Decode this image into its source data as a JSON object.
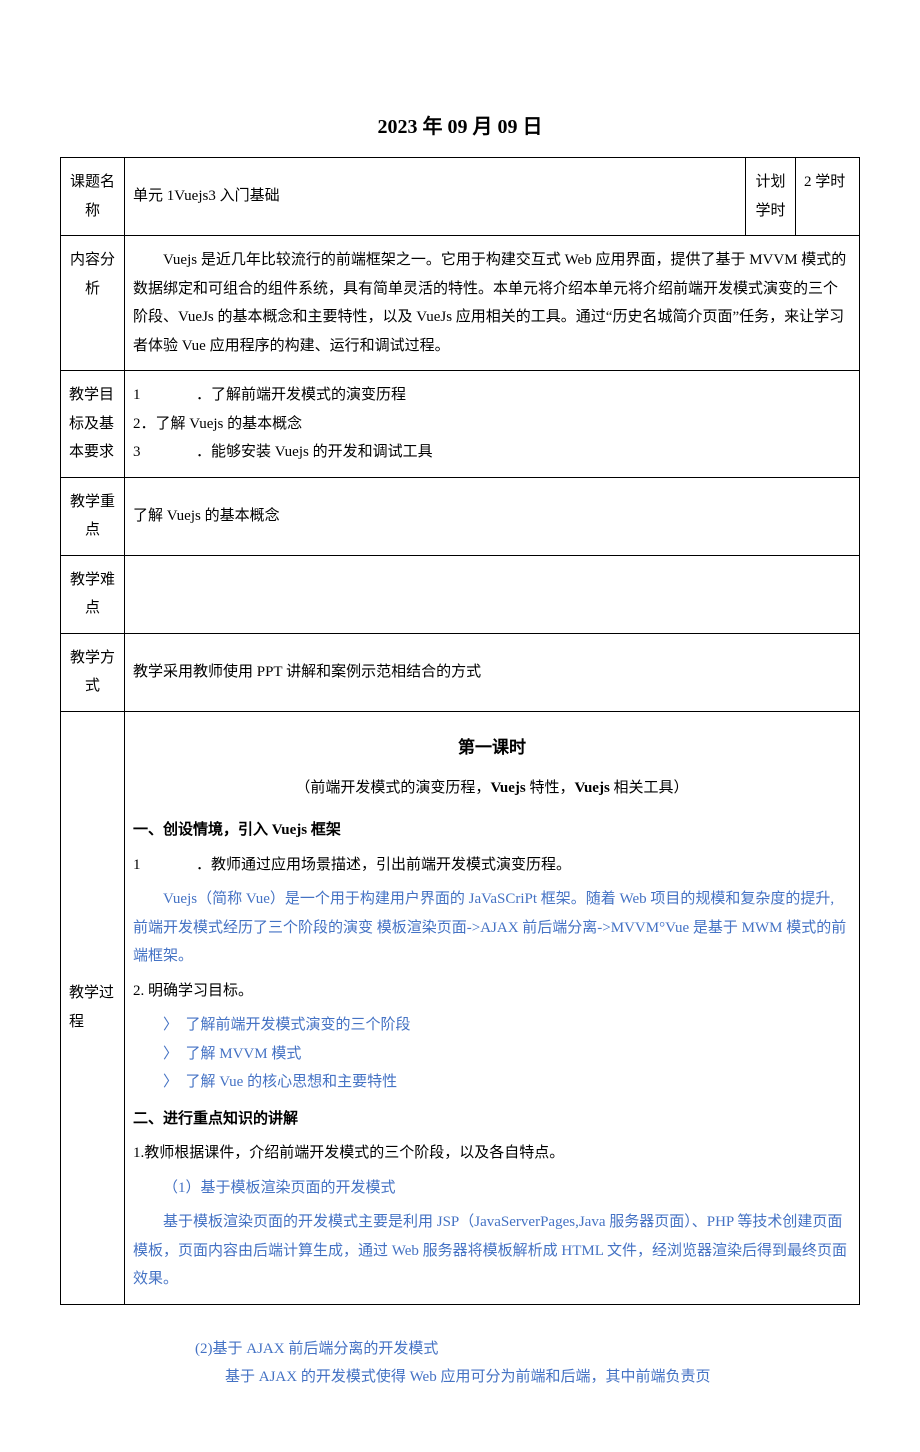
{
  "title": "2023 年 09 月 09 日",
  "row1": {
    "label": "课题名称",
    "content": "单元 1Vuejs3 入门基础",
    "plan_label": "计划学时",
    "plan_value": "2 学时"
  },
  "row2": {
    "label": "内容分析",
    "content": "Vuejs 是近几年比较流行的前端框架之一。它用于构建交互式 Web 应用界面，提供了基于 MVVM 模式的数据绑定和可组合的组件系统，具有简单灵活的特性。本单元将介绍本单元将介绍前端开发模式演变的三个阶段、VueJs 的基本概念和主要特性，以及 VueJs 应用相关的工具。通过“历史名城简介页面”任务，来让学习者体验 Vue 应用程序的构建、运行和调试过程。"
  },
  "row3": {
    "label": "教学目标及基本要求",
    "items": [
      {
        "num": "1",
        "text": "．了解前端开发模式的演变历程"
      },
      {
        "num": "2．",
        "text": "了解 Vuejs 的基本概念"
      },
      {
        "num": "3",
        "text": "．能够安装 Vuejs 的开发和调试工具"
      }
    ]
  },
  "row4": {
    "label": "教学重点",
    "content": "了解 Vuejs 的基本概念"
  },
  "row5": {
    "label": "教学难点",
    "content": ""
  },
  "row6": {
    "label": "教学方式",
    "content": "教学采用教师使用 PPT 讲解和案例示范相结合的方式"
  },
  "row7": {
    "label": "教学过程",
    "section_title": "第一课时",
    "section_sub_a": "（前端开发模式的演变历程，",
    "section_sub_b": "Vuejs",
    "section_sub_c": " 特性，",
    "section_sub_d": "Vuejs",
    "section_sub_e": " 相关工具）",
    "h1_a": "一、创设情境，引入 ",
    "h1_b": "Vuejs",
    "h1_c": " 框架",
    "p1_num": "1",
    "p1_text": "．教师通过应用场景描述，引出前端开发模式演变历程。",
    "p2": "Vuejs（简称 Vue）是一个用于构建用户界面的 JaVaSCriPt 框架。随着 Web 项目的规模和复杂度的提升, 前端开发模式经历了三个阶段的演变 模板渲染页面->AJAX 前后端分离->MVVM°Vue 是基于 MWM 模式的前端框架。",
    "p3_label": "2. 明确学习目标。",
    "bullets": [
      "了解前端开发模式演变的三个阶段",
      "了解 MVVM 模式",
      "了解 Vue 的核心思想和主要特性"
    ],
    "h2": "二、进行重点知识的讲解",
    "p4": "1.教师根据课件，介绍前端开发模式的三个阶段，以及各自特点。",
    "p5": "（1）基于模板渲染页面的开发模式",
    "p6": "基于模板渲染页面的开发模式主要是利用 JSP（JavaServerPages,Java 服务器页面）、PHP 等技术创建页面模板，页面内容由后端计算生成，通过 Web 服务器将模板解析成 HTML 文件，经浏览器渲染后得到最终页面效果。"
  },
  "footer": {
    "p1": "(2)基于 AJAX 前后端分离的开发模式",
    "p2": "基于 AJAX 的开发模式使得 Web 应用可分为前端和后端，其中前端负责页"
  }
}
